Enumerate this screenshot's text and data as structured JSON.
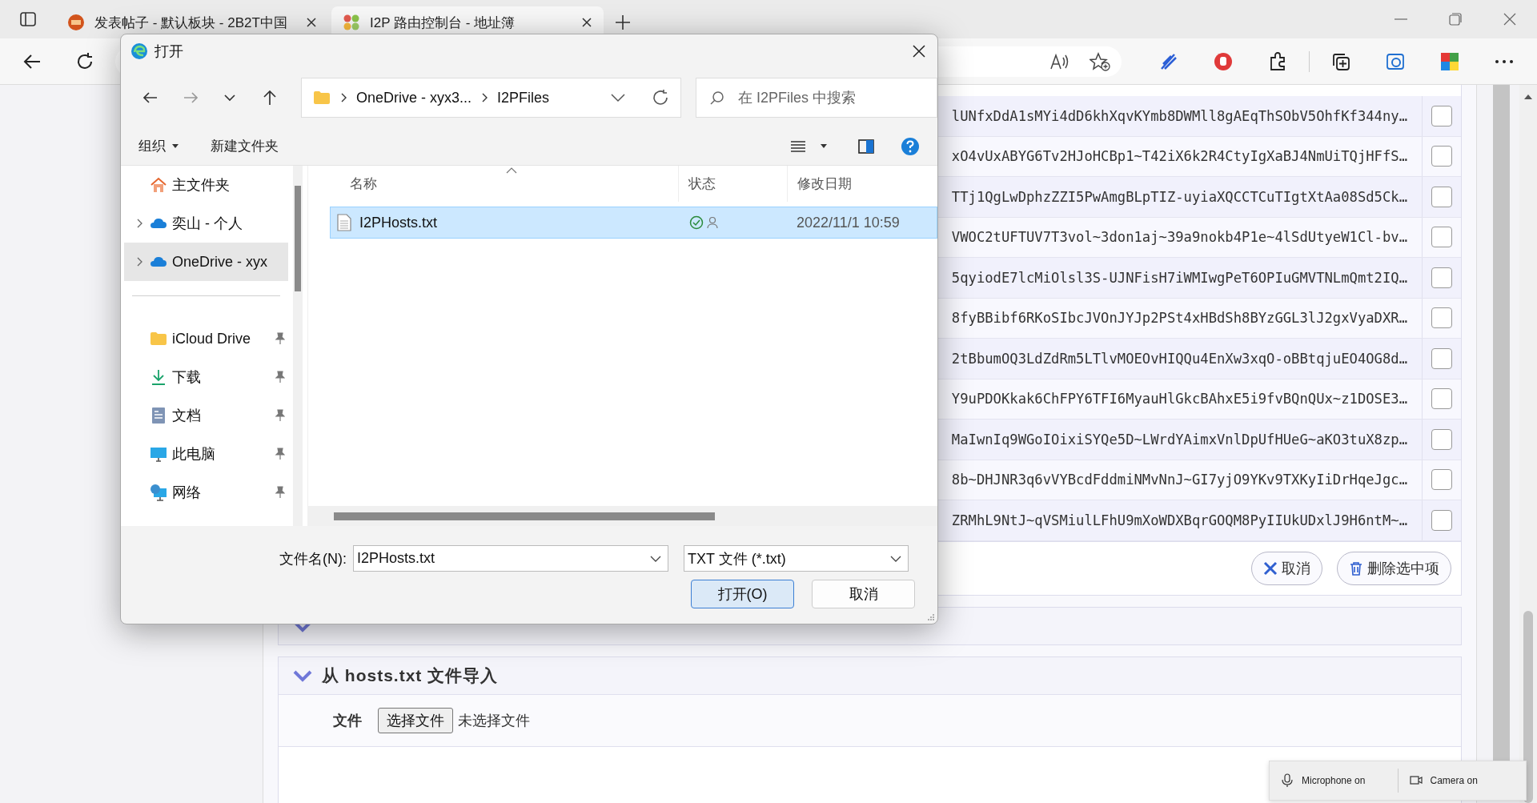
{
  "browser": {
    "tabs": [
      {
        "title": "发表帖子 - 默认板块 - 2B2T中国",
        "selected": false
      },
      {
        "title": "I2P 路由控制台 - 地址簿",
        "selected": true
      }
    ]
  },
  "page": {
    "table": {
      "rows": [
        {
          "destination": "lUNfxDdA1sMYi4dD6khXqvKYmb8DWMll8gAEqThSObV5OhfKf344ny…",
          "checked": false
        },
        {
          "destination": "xO4vUxABYG6Tv2HJoHCBp1~T42iX6k2R4CtyIgXaBJ4NmUiTQjHFfS…",
          "checked": false
        },
        {
          "destination": "TTj1QgLwDphzZZI5PwAmgBLpTIZ-uyiaXQCCTCuTIgtXtAa08Sd5Ck…",
          "checked": false
        },
        {
          "destination": "VWOC2tUFTUV7T3vol~3don1aj~39a9nokb4P1e~4lSdUtyeW1Cl-bv…",
          "checked": false
        },
        {
          "destination": "5qyiodE7lcMiOlsl3S-UJNFisH7iWMIwgPeT6OPIuGMVTNLmQmt2IQ…",
          "checked": false
        },
        {
          "destination": "8fyBBibf6RKoSIbcJVOnJYJp2PSt4xHBdSh8BYzGGL3lJ2gxVyaDXR…",
          "checked": false
        },
        {
          "destination": "2tBbumOQ3LdZdRm5LTlvMOEOvHIQQu4EnXw3xqO-oBBtqjuEO4OG8d…",
          "checked": false
        },
        {
          "destination": "Y9uPDOKkak6ChFPY6TFI6MyauHlGkcBAhxE5i9fvBQnQUx~z1DOSE3…",
          "checked": false
        },
        {
          "destination": "MaIwnIq9WGoIOixiSYQe5D~LWrdYAimxVnlDpUfHUeG~aKO3tuX8zp…",
          "checked": false
        },
        {
          "destination": "8b~DHJNR3q6vVYBcdFddmiNMvNnJ~GI7yjO9YKv9TXKyIiDrHqeJgc…",
          "checked": false
        },
        {
          "destination": "ZRMhL9NtJ~qVSMiulLFhU9mXoWDXBqrGOQM8PyIIUkUDxlJ9H6ntM~…",
          "checked": false
        }
      ]
    },
    "actions": [
      {
        "label": "取消"
      },
      {
        "label": "删除选中项"
      }
    ],
    "sections": [
      {
        "title": "从 hosts.txt 文件导入",
        "file_label": "文件",
        "file_button": "选择文件",
        "file_status": "未选择文件"
      }
    ]
  },
  "dialog": {
    "title": "打开",
    "path": [
      "OneDrive - xyx3...",
      "I2PFiles"
    ],
    "search": {
      "placeholder": "在 I2PFiles 中搜索"
    },
    "commands": [
      "组织",
      "新建文件夹"
    ],
    "nav": [
      {
        "label": "主文件夹",
        "kind": "home",
        "selected": false,
        "expandable": false,
        "pinned": false
      },
      {
        "label": "奕山 - 个人",
        "kind": "cloud",
        "selected": false,
        "expandable": true,
        "pinned": false
      },
      {
        "label": "OneDrive - xyx",
        "kind": "cloud",
        "selected": true,
        "expandable": true,
        "pinned": false
      },
      {
        "label": "iCloud Drive",
        "kind": "folder",
        "selected": false,
        "expandable": false,
        "pinned": true
      },
      {
        "label": "下载",
        "kind": "download",
        "selected": false,
        "expandable": false,
        "pinned": true
      },
      {
        "label": "文档",
        "kind": "document",
        "selected": false,
        "expandable": false,
        "pinned": true
      },
      {
        "label": "此电脑",
        "kind": "computer",
        "selected": false,
        "expandable": false,
        "pinned": true
      },
      {
        "label": "网络",
        "kind": "network",
        "selected": false,
        "expandable": false,
        "pinned": true
      }
    ],
    "columns": [
      "名称",
      "状态",
      "修改日期"
    ],
    "files": [
      {
        "name": "I2PHosts.txt",
        "date": "2022/11/1 10:59",
        "selected": true
      }
    ],
    "filename_label": "文件名(N):",
    "filename": "I2PHosts.txt",
    "filetype": "TXT 文件 (*.txt)",
    "buttons": [
      {
        "label": "打开(O)",
        "default": true
      },
      {
        "label": "取消",
        "default": false
      }
    ]
  },
  "notification": {
    "items": [
      {
        "label": "Microphone on",
        "kind": "microphone"
      },
      {
        "label": "Camera on",
        "kind": "camera"
      }
    ]
  }
}
